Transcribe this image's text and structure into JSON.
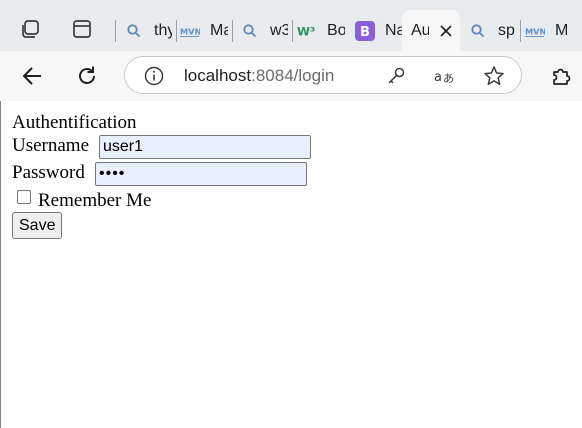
{
  "tabs": [
    {
      "title": "thy",
      "icon": "search-icon"
    },
    {
      "title": "Ma",
      "icon": "mvn-icon"
    },
    {
      "title": "w3",
      "icon": "search-icon"
    },
    {
      "title": "Bo",
      "icon": "w3schools-icon"
    },
    {
      "title": "Na",
      "icon": "bootstrap-icon"
    },
    {
      "title": "Au",
      "icon": "blank-page-icon",
      "active": true
    },
    {
      "title": "sp",
      "icon": "search-icon"
    },
    {
      "title": "M",
      "icon": "mvn-icon"
    }
  ],
  "favicon_labels": {
    "mvn": "MVN",
    "bootstrap": "B",
    "w3": "W³"
  },
  "address_bar": {
    "host": "localhost",
    "port": ":8084",
    "path": "/login"
  },
  "page": {
    "heading": "Authentification",
    "username_label": "Username",
    "username_value": "user1",
    "password_label": "Password",
    "password_value": "••••",
    "remember_label": "Remember Me",
    "remember_checked": false,
    "save_label": "Save"
  },
  "colors": {
    "tabstrip_bg": "#e9ecef",
    "toolbar_bg": "#f7f7f7",
    "autofill_bg": "#e8f0fe",
    "bootstrap_purple": "#8c5fd6",
    "w3_green": "#2f8f5e",
    "mvn_blue": "#5e8fc8"
  }
}
